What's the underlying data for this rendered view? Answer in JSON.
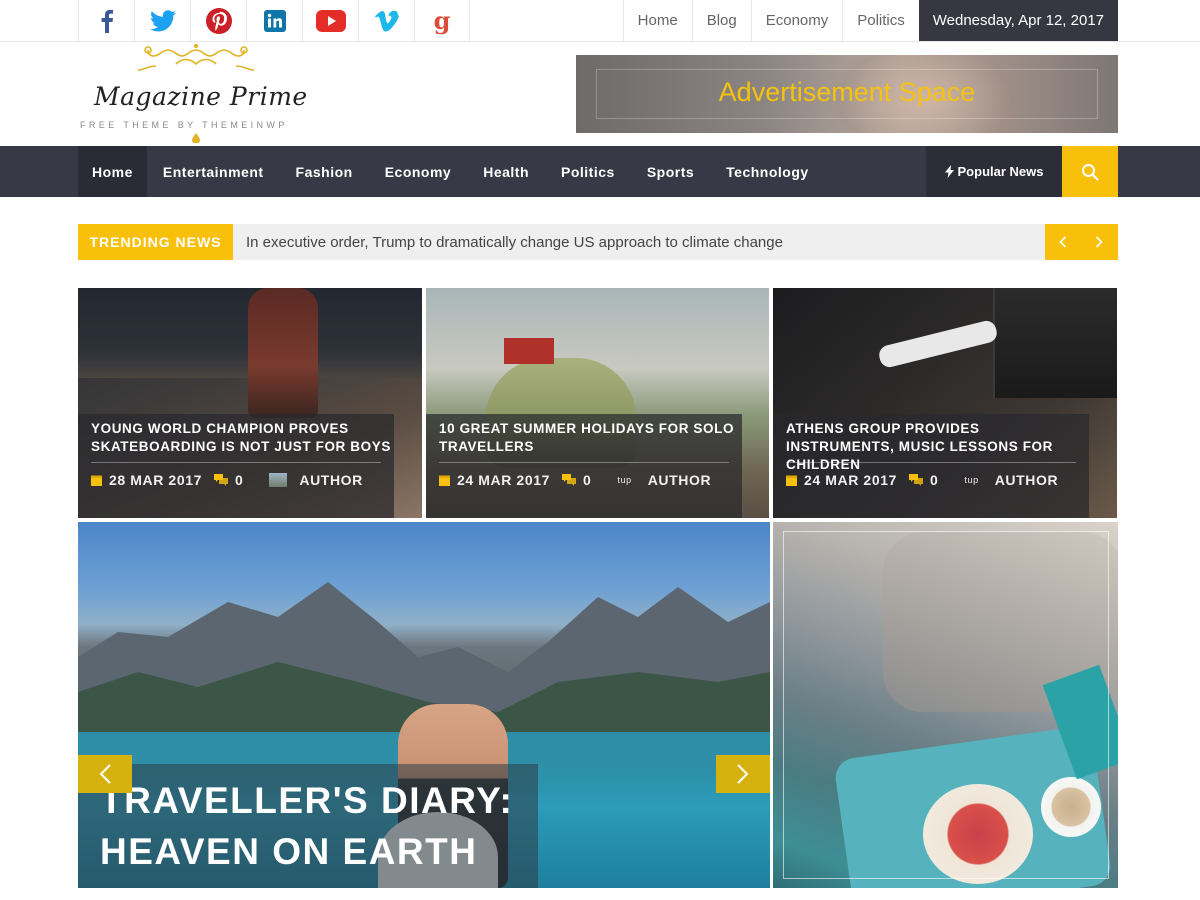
{
  "social": [
    "facebook-icon",
    "twitter-icon",
    "pinterest-icon",
    "linkedin-icon",
    "youtube-icon",
    "vimeo-icon",
    "google-plus-icon"
  ],
  "top_links": [
    "Home",
    "Blog",
    "Economy",
    "Politics"
  ],
  "date": "Wednesday, Apr 12, 2017",
  "logo": {
    "title": "Magazine Prime",
    "tagline": "FREE THEME BY THEMEINWP"
  },
  "ad": {
    "text": "Advertisement Space"
  },
  "nav": {
    "items": [
      "Home",
      "Entertainment",
      "Fashion",
      "Economy",
      "Health",
      "Politics",
      "Sports",
      "Technology"
    ],
    "popular": "Popular News"
  },
  "trending": {
    "label": "TRENDING NEWS",
    "headline": "In executive order, Trump to dramatically change US approach to climate change"
  },
  "cards": [
    {
      "title": "YOUNG WORLD CHAMPION PROVES SKATEBOARDING IS NOT JUST FOR BOYS",
      "date": "28 MAR 2017",
      "comments": "0",
      "author": "AUTHOR"
    },
    {
      "title": "10 GREAT SUMMER HOLIDAYS FOR SOLO TRAVELLERS",
      "date": "24 MAR 2017",
      "comments": "0",
      "author": "AUTHOR"
    },
    {
      "title": "ATHENS GROUP PROVIDES INSTRUMENTS, MUSIC LESSONS FOR CHILDREN",
      "date": "24 MAR 2017",
      "comments": "0",
      "author": "AUTHOR"
    }
  ],
  "featured": {
    "line1": "TRAVELLER'S DIARY:",
    "line2": "HEAVEN ON EARTH"
  },
  "colors": {
    "accent": "#f8c00b",
    "nav_bg": "#383946",
    "date_bg": "#373742"
  }
}
